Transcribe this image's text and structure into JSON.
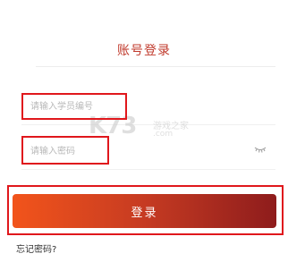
{
  "login": {
    "title": "账号登录",
    "username_placeholder": "请输入学员编号",
    "password_placeholder": "请输入密码",
    "login_button": "登录",
    "forgot_password": "忘记密码?"
  },
  "watermark": {
    "logo": "K73",
    "tagline": "游戏之家",
    "url": ".com"
  },
  "colors": {
    "title": "#c0392b",
    "button_gradient_start": "#f2541b",
    "button_gradient_end": "#8e1c1c",
    "annotation_border": "#e0171c"
  },
  "icons": {
    "password_toggle": "eye-closed-icon"
  }
}
